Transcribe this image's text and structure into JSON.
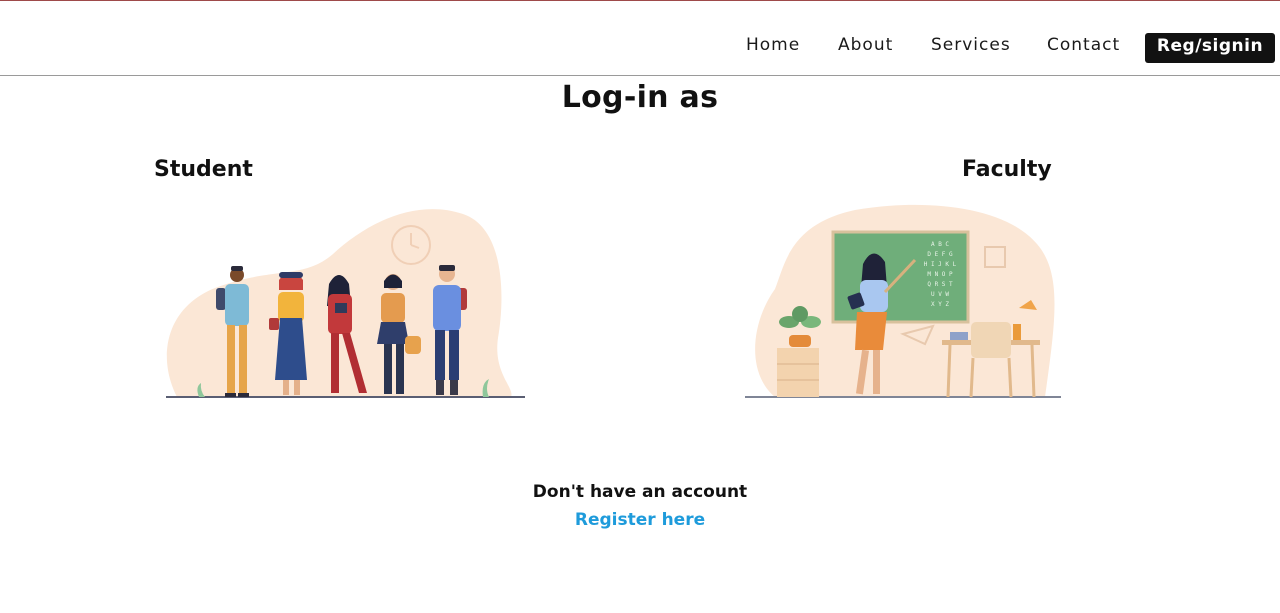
{
  "nav": {
    "home": "Home",
    "about": "About",
    "services": "Services",
    "contact": "Contact",
    "reg_signin": "Reg/signin"
  },
  "main": {
    "title": "Log-in as",
    "student_label": "Student",
    "faculty_label": "Faculty"
  },
  "signup": {
    "prompt": "Don't have an account",
    "link": "Register here"
  },
  "colors": {
    "accent_link": "#1e9bdb",
    "button_bg": "#121212",
    "illustration_blob": "#fbe7d6"
  },
  "icons": {
    "student": "students-group-illustration",
    "faculty": "teacher-at-chalkboard-illustration"
  },
  "chalkboard": {
    "rows": [
      "A B C",
      "D E F G",
      "H I J K L",
      "M N O P",
      "Q R S T",
      "U V W",
      "X Y Z"
    ]
  }
}
